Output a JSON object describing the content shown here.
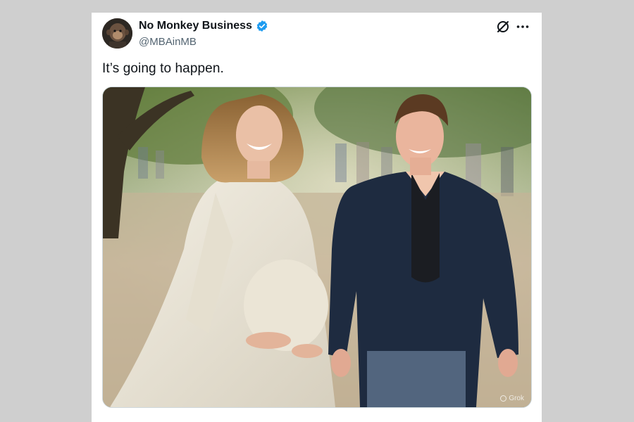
{
  "tweet": {
    "author": {
      "display_name": "No Monkey Business",
      "handle": "@MBAinMB",
      "verified": true,
      "avatar_icon": "monkey-avatar"
    },
    "text": "It’s going to happen.",
    "media": {
      "kind": "image",
      "watermark": "Grok"
    },
    "actions": {
      "grok_icon": "grok-icon",
      "more_icon": "more-horizontal-icon"
    }
  },
  "colors": {
    "verified_blue": "#1d9bf0",
    "text_primary": "#0f1419",
    "text_secondary": "#536471",
    "page_background": "#cfcfcf"
  }
}
